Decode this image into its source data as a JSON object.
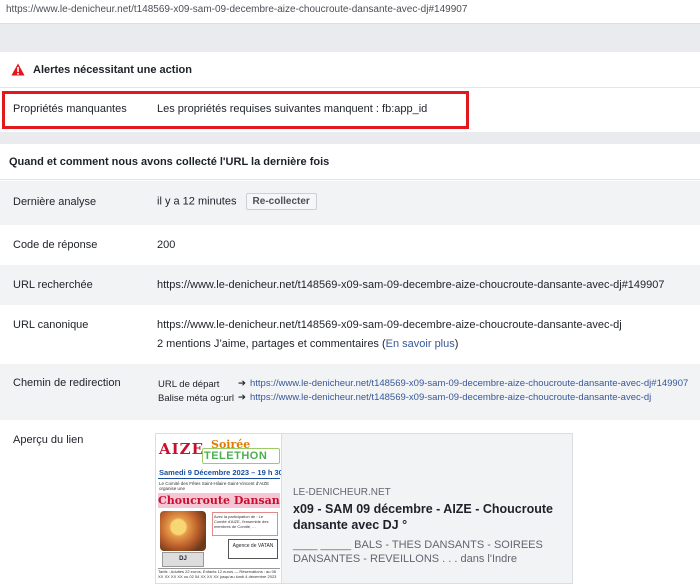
{
  "top_url": "https://www.le-denicheur.net/t148569-x09-sam-09-decembre-aize-choucroute-dansante-avec-dj#149907",
  "alerts": {
    "title": "Alertes nécessitant une action",
    "row_label": "Propriétés manquantes",
    "row_value": "Les propriétés requises suivantes manquent : fb:app_id"
  },
  "scrape": {
    "title": "Quand et comment nous avons collecté l'URL la dernière fois",
    "last_scan_label": "Dernière analyse",
    "last_scan_value": "il y a 12 minutes",
    "rescrape_button": "Re-collecter",
    "response_code_label": "Code de réponse",
    "response_code_value": "200",
    "fetched_url_label": "URL recherchée",
    "fetched_url_value": "https://www.le-denicheur.net/t148569-x09-sam-09-decembre-aize-choucroute-dansante-avec-dj#149907",
    "canonical_label": "URL canonique",
    "canonical_value": "https://www.le-denicheur.net/t148569-x09-sam-09-decembre-aize-choucroute-dansante-avec-dj",
    "mentions_text": "2 mentions J’aime, partages et commentaires (",
    "mentions_link": "En savoir plus",
    "mentions_close": ")",
    "redirect_label": "Chemin de redirection",
    "redirect_start_label": "URL de départ",
    "redirect_start_value": "https://www.le-denicheur.net/t148569-x09-sam-09-decembre-aize-choucroute-dansante-avec-dj#149907",
    "redirect_og_label": "Balise méta og:url",
    "redirect_og_value": "https://www.le-denicheur.net/t148569-x09-sam-09-decembre-aize-choucroute-dansante-avec-dj",
    "preview_label": "Aperçu du lien"
  },
  "preview": {
    "site": "LE-DENICHEUR.NET",
    "title": "x09 - SAM 09 décembre - AIZE - Choucroute dansante avec DJ °",
    "description": "____ _____ BALS - THES DANSANTS - SOIREES DANSANTES - REVEILLONS . . . dans l'Indre",
    "poster": {
      "aize": "AIZE",
      "soiree": "Soirée",
      "telethon": "TELETHON",
      "date": "Samedi 9 Décembre 2023 – 19 h 30",
      "intro": "Le Comité des Fêtes Saint-Hilaire-Saint-Vincent d'AIZE organise une",
      "choucroute": "Choucroute Dansante",
      "participation": "Avec la participation de : Le Comité d'AIZE, l'ensemble des membres de Comité, ...",
      "dj": "DJ",
      "agency": "Agence de VATAN",
      "footer": "Tarifs : Adultes 22 euros, Enfants 12 euros — Réservations : au 06 XX XX XX XX ou 02 54 XX XX XX jusqu'au lundi 4 décembre 2023"
    }
  },
  "colors": {
    "alert_red": "#e1191f",
    "link": "#365899",
    "panel_bg": "#e9ebee"
  }
}
